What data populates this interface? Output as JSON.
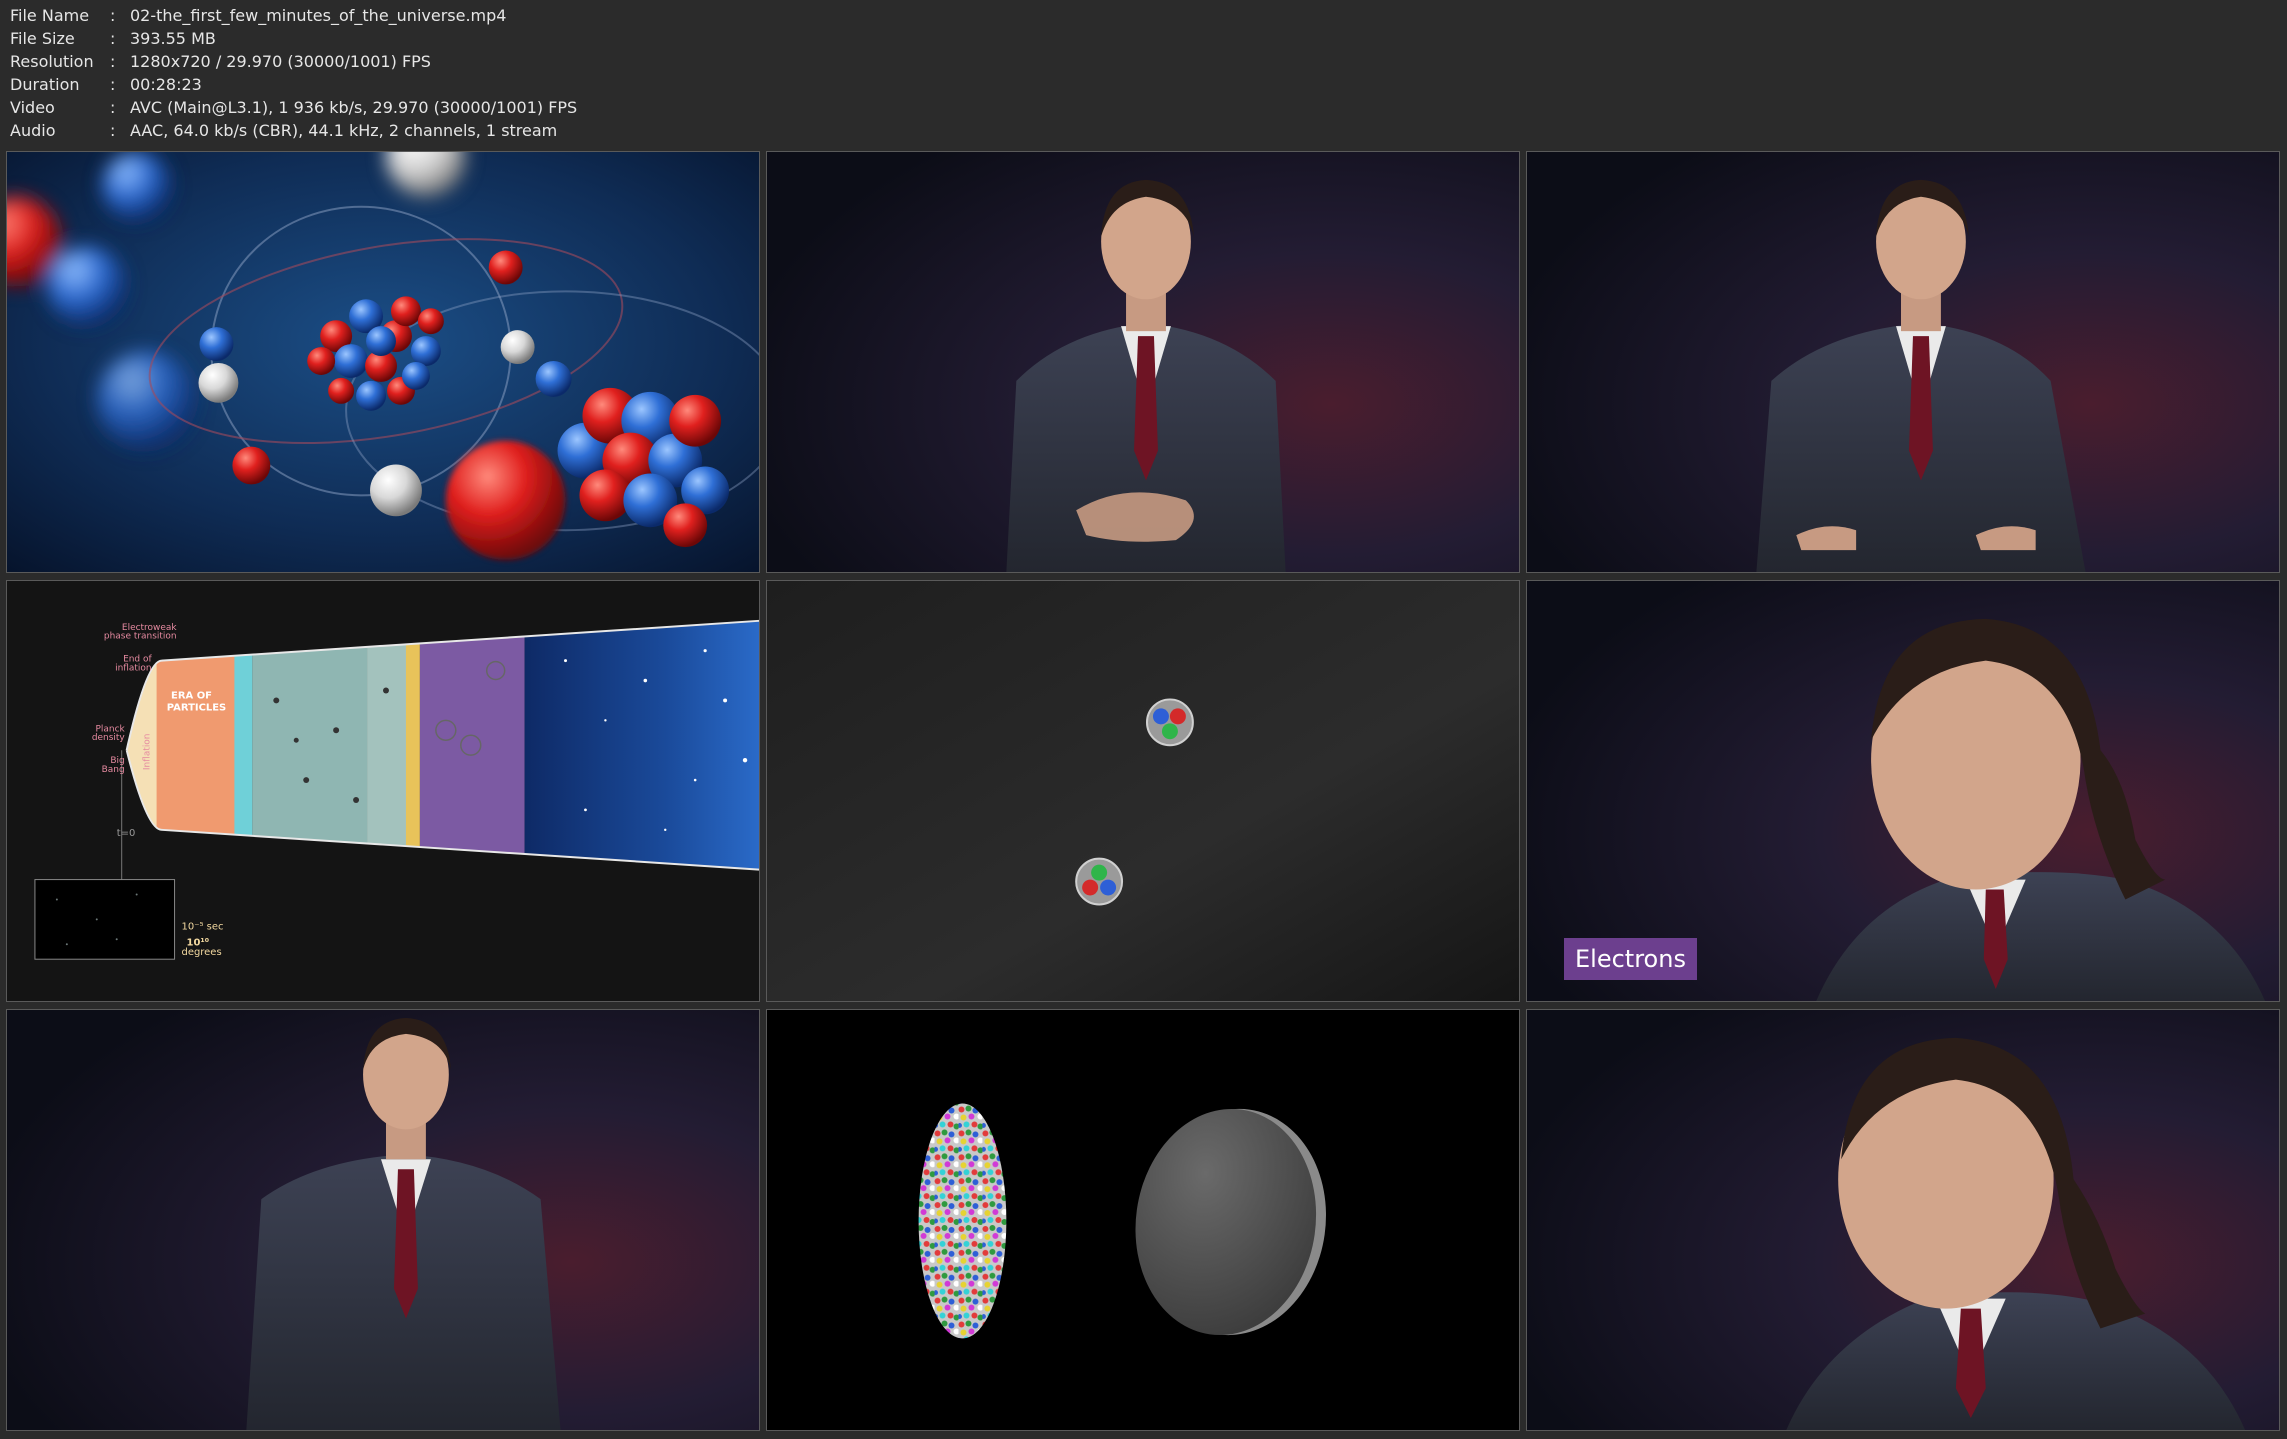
{
  "file_info": [
    {
      "key": "File Name",
      "sep": ":",
      "value": "02-the_first_few_minutes_of_the_universe.mp4"
    },
    {
      "key": "File Size",
      "sep": ":",
      "value": "393.55 MB"
    },
    {
      "key": "Resolution",
      "sep": ":",
      "value": "1280x720 / 29.970 (30000/1001) FPS"
    },
    {
      "key": "Duration",
      "sep": ":",
      "value": "00:28:23"
    },
    {
      "key": "Video",
      "sep": ":",
      "value": "AVC (Main@L3.1), 1 936 kb/s, 29.970 (30000/1001) FPS"
    },
    {
      "key": "Audio",
      "sep": ":",
      "value": "AAC, 64.0 kb/s (CBR), 44.1 kHz, 2 channels, 1 stream"
    }
  ],
  "frames": {
    "f4": {
      "labels": {
        "electroweak1": "Electroweak",
        "electroweak2": "phase transition",
        "endinf1": "End of",
        "endinf2": "inflation",
        "planck1": "Planck",
        "planck2": "density",
        "big1": "Big",
        "big2": "Bang",
        "inflation": "Inflation",
        "era1": "ERA OF",
        "era2": "PARTICLES",
        "t0": "t=0",
        "time": "10⁻⁵ sec",
        "temp": "10¹⁰",
        "degrees": "degrees"
      }
    },
    "f6": {
      "caption": "Electrons"
    }
  },
  "colors": {
    "caption_bg": "#6c3f8e",
    "page_bg": "#2b2b2b"
  }
}
